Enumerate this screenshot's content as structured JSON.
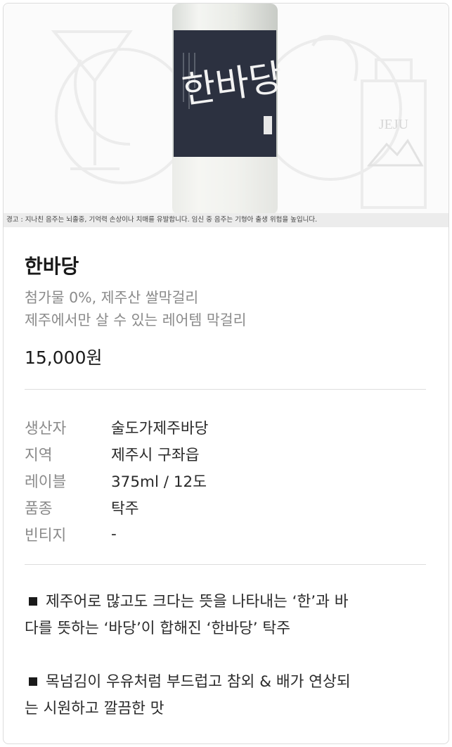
{
  "hero": {
    "warning_text": "경고 : 지나친 음주는 뇌졸중, 기억력 손상이나 치매를 유발합니다. 임신 중 음주는 기형아 출생 위험을 높입니다.",
    "label_text": "한바당",
    "bg_mark": "JEJU"
  },
  "product": {
    "name": "한바당",
    "subtitle_1": "첨가물 0%, 제주산 쌀막걸리",
    "subtitle_2": "제주에서만 살 수 있는 레어템 막걸리",
    "price": "15,000원"
  },
  "specs": [
    {
      "label": "생산자",
      "value": "술도가제주바당"
    },
    {
      "label": "지역",
      "value": "제주시 구좌읍"
    },
    {
      "label": "레이블",
      "value": "375ml / 12도"
    },
    {
      "label": "품종",
      "value": "탁주"
    },
    {
      "label": "빈티지",
      "value": "-"
    }
  ],
  "description": {
    "para_1_line_1": "제주어로 많고도 크다는 뜻을 나타내는 ‘한’과 바",
    "para_1_line_2": "다를 뜻하는 ‘바당’이 합해진 ‘한바당’ 탁주",
    "para_2_line_1": "목넘김이 우유처럼 부드럽고 참외 & 배가 연상되",
    "para_2_line_2": "는 시원하고 깔끔한 맛"
  },
  "colors": {
    "label_bg": "#2c3140",
    "text_primary": "#1a1a1a",
    "text_muted": "#8a8a8a",
    "divider": "#dddddd"
  }
}
